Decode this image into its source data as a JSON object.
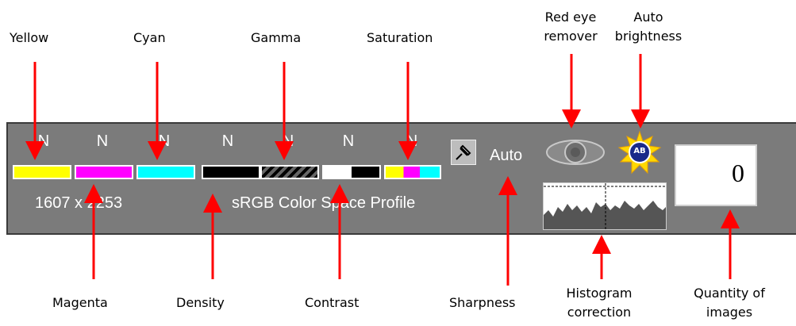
{
  "callouts": {
    "yellow": "Yellow",
    "cyan": "Cyan",
    "gamma": "Gamma",
    "saturation": "Saturation",
    "red_eye": [
      "Red eye",
      "remover"
    ],
    "auto_brightness": [
      "Auto",
      "brightness"
    ],
    "magenta": "Magenta",
    "density": "Density",
    "contrast": "Contrast",
    "sharpness": "Sharpness",
    "histogram": [
      "Histogram",
      "correction"
    ],
    "quantity": [
      "Quantity of",
      "images"
    ]
  },
  "panel": {
    "n_labels": [
      "N",
      "N",
      "N",
      "N",
      "N",
      "N",
      "N"
    ],
    "size_label": "1607 x 2253",
    "profile_label": "sRGB Color Space Profile",
    "sharpness_value": "Auto",
    "auto_brightness_badge": "AB",
    "quantity_value": "0"
  },
  "colors": {
    "yellow": "#ffff00",
    "magenta": "#ff00ff",
    "cyan": "#00ffff",
    "arrow": "#ff0000",
    "panel": "#7b7b7b"
  },
  "icons": {
    "pin": "pushpin-icon",
    "eye": "eye-icon",
    "sun": "sun-icon"
  }
}
